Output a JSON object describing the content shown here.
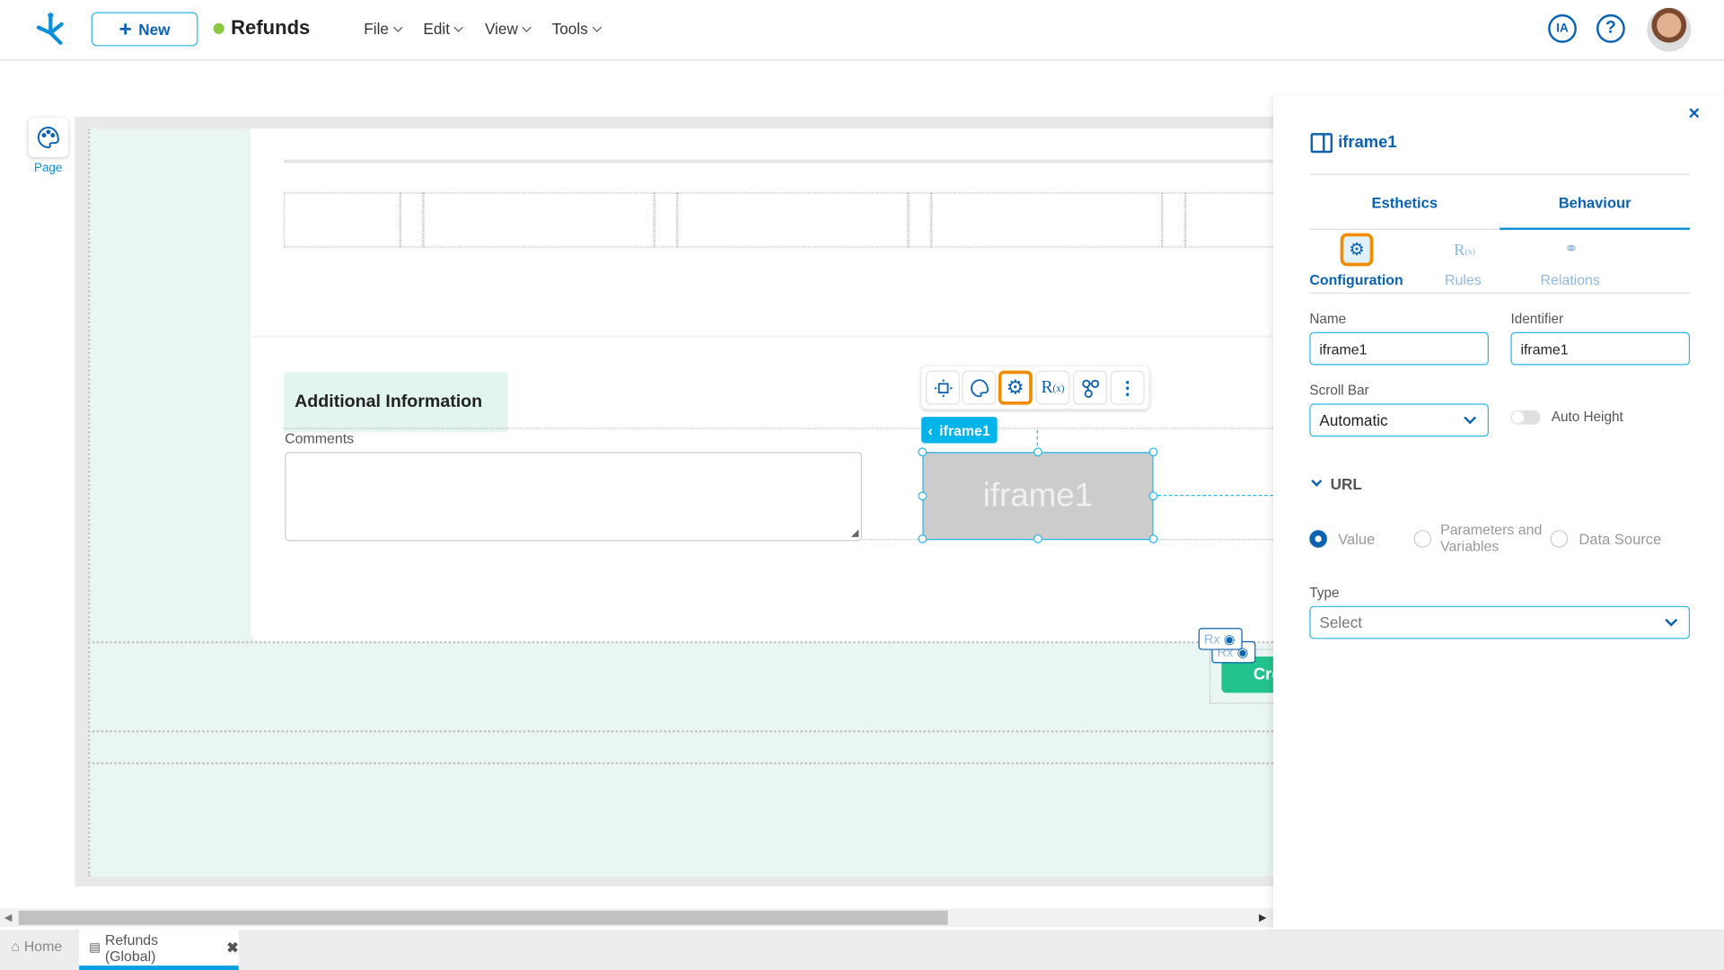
{
  "header": {
    "new_label": "New",
    "app_title": "Refunds",
    "status_color": "#8dc63f",
    "menus": [
      "File",
      "Edit",
      "View",
      "Tools"
    ],
    "ia_label": "IA"
  },
  "toolbar": {
    "width_readout": "1382px"
  },
  "left_sidebar": {
    "page_label": "Page"
  },
  "canvas": {
    "section_title": "Additional Information",
    "comments_label": "Comments",
    "selected_tag": "iframe1",
    "iframe_placeholder": "iframe1",
    "rx_label": "Rx",
    "create_button_partial": "Cre"
  },
  "bottom_tabs": {
    "home": "Home",
    "active": "Refunds (Global)"
  },
  "panel": {
    "title": "iframe1",
    "tabs": [
      "Esthetics",
      "Behaviour"
    ],
    "active_tab": "Behaviour",
    "subtabs": [
      "Configuration",
      "Rules",
      "Relations"
    ],
    "active_subtab": "Configuration",
    "name_label": "Name",
    "name_value": "iframe1",
    "identifier_label": "Identifier",
    "identifier_value": "iframe1",
    "scroll_label": "Scroll Bar",
    "scroll_value": "Automatic",
    "auto_height_label": "Auto Height",
    "auto_height_on": false,
    "url_section": "URL",
    "url_options": [
      "Value",
      "Parameters and Variables",
      "Data Source"
    ],
    "url_selected": "Value",
    "type_label": "Type",
    "type_placeholder": "Select"
  },
  "colors": {
    "accent": "#0a62b0",
    "selection": "#00b4ea",
    "highlight": "#f08c00",
    "create_green": "#22c38e"
  }
}
